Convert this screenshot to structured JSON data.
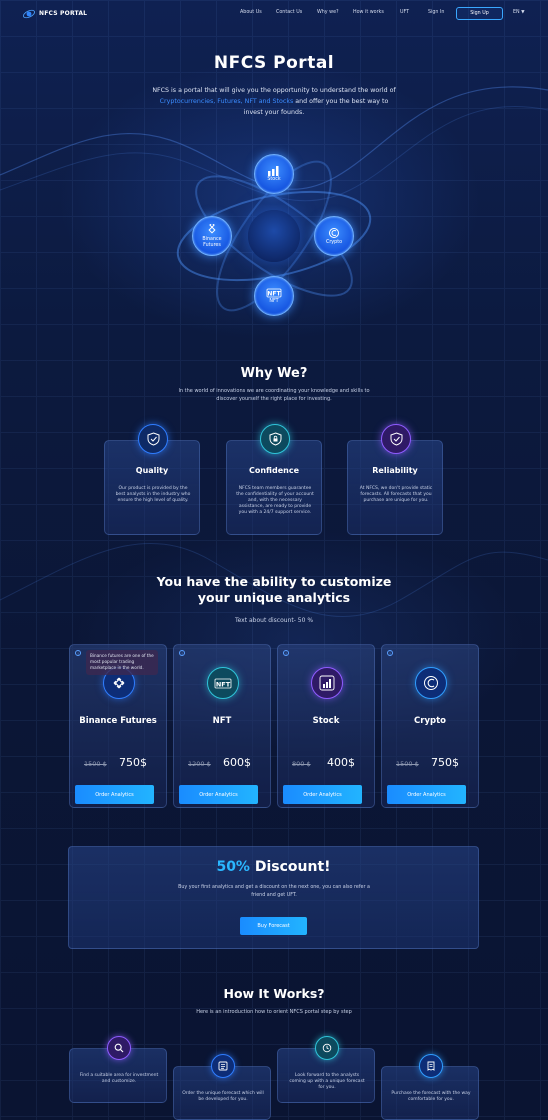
{
  "nav": {
    "logo": "NFCS PORTAL",
    "links": [
      "About Us",
      "Contact Us",
      "Why we?",
      "How it works",
      "UFT",
      "Sign In"
    ],
    "signup": "Sign Up",
    "lang": "EN"
  },
  "hero": {
    "title": "NFCS Portal",
    "desc_a": "NFCS is a portal that will give you the opportunity to understand the world of ",
    "desc_highlight": "Cryptocurrencies, Futures, NFT and Stocks",
    "desc_b": " and offer you the best way to invest your founds.",
    "nodes": {
      "stock": "Stock",
      "binance_futures": "Binance Futures",
      "crypto": "Crypto",
      "nft": "NFT"
    }
  },
  "why": {
    "title": "Why We?",
    "desc": "In the world of innovations we are coordinating your knowledge and skills to discover yourself the right place for investing.",
    "cards": [
      {
        "name": "Quality",
        "text": "Our product is provided by the best analysts in the industry who ensure the high level of quality."
      },
      {
        "name": "Confidence",
        "text": "NFCS team members guarantee the confidentiality of your account and, with the necessary assistance, are ready to provide you with a 24/7 support service."
      },
      {
        "name": "Reliability",
        "text": "At NFCS, we don't provide static forecasts. All forecasts that you purchase are unique for you."
      }
    ]
  },
  "products": {
    "title": "You have the ability to customize your unique analytics",
    "subtitle": "Text about discount- 50 %",
    "tooltip": "Binance futures are one of the most popular trading marketplace in the world.",
    "order_label": "Order Analytics",
    "items": [
      {
        "name": "Binance Futures",
        "old_price": "1500 $",
        "new_price": "750$"
      },
      {
        "name": "NFT",
        "old_price": "1200 $",
        "new_price": "600$"
      },
      {
        "name": "Stock",
        "old_price": "800 $",
        "new_price": "400$"
      },
      {
        "name": "Crypto",
        "old_price": "1500 $",
        "new_price": "750$"
      }
    ]
  },
  "discount": {
    "pct": "50%",
    "word": " Discount!",
    "text": "Buy your first analytics and get a discount on the next one, you can also refer a friend and get UFT.",
    "button": "Buy Forecast"
  },
  "how": {
    "title": "How It Works?",
    "desc": "Here is an introduction how to orient NFCS portal step by step",
    "steps": [
      "Find a suitable area for investment and customize.",
      "Order the unique forecast which will be developed for you.",
      "Look forward to the analysts coming up with a unique forecast for you.",
      "Purchase the forecast with the way comfortable for you."
    ]
  },
  "colors": {
    "accent": "#2ab6ff",
    "brand_blue": "#1a8cff",
    "background": "#0b1530"
  }
}
